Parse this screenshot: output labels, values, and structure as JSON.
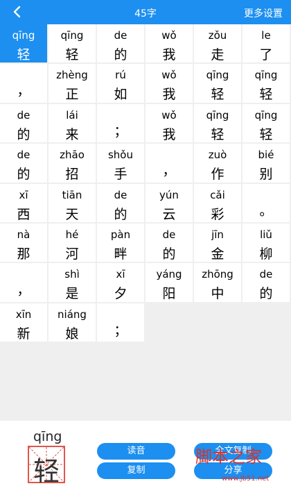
{
  "header": {
    "title": "45字",
    "more_label": "更多设置"
  },
  "cells": [
    {
      "py": "qīng",
      "hz": "轻",
      "selected": true
    },
    {
      "py": "qīng",
      "hz": "轻"
    },
    {
      "py": "de",
      "hz": "的"
    },
    {
      "py": "wǒ",
      "hz": "我"
    },
    {
      "py": "zǒu",
      "hz": "走"
    },
    {
      "py": "le",
      "hz": "了"
    },
    {
      "py": "",
      "hz": "，"
    },
    {
      "py": "zhèng",
      "hz": "正"
    },
    {
      "py": "rú",
      "hz": "如"
    },
    {
      "py": "wǒ",
      "hz": "我"
    },
    {
      "py": "qīng",
      "hz": "轻"
    },
    {
      "py": "qīng",
      "hz": "轻"
    },
    {
      "py": "de",
      "hz": "的"
    },
    {
      "py": "lái",
      "hz": "来"
    },
    {
      "py": "",
      "hz": "；"
    },
    {
      "py": "wǒ",
      "hz": "我"
    },
    {
      "py": "qīng",
      "hz": "轻"
    },
    {
      "py": "qīng",
      "hz": "轻"
    },
    {
      "py": "de",
      "hz": "的"
    },
    {
      "py": "zhāo",
      "hz": "招"
    },
    {
      "py": "shǒu",
      "hz": "手"
    },
    {
      "py": "",
      "hz": "，"
    },
    {
      "py": "zuò",
      "hz": "作"
    },
    {
      "py": "bié",
      "hz": "别"
    },
    {
      "py": "xī",
      "hz": "西"
    },
    {
      "py": "tiān",
      "hz": "天"
    },
    {
      "py": "de",
      "hz": "的"
    },
    {
      "py": "yún",
      "hz": "云"
    },
    {
      "py": "cǎi",
      "hz": "彩"
    },
    {
      "py": "",
      "hz": "。"
    },
    {
      "py": "nà",
      "hz": "那"
    },
    {
      "py": "hé",
      "hz": "河"
    },
    {
      "py": "pàn",
      "hz": "畔"
    },
    {
      "py": "de",
      "hz": "的"
    },
    {
      "py": "jīn",
      "hz": "金"
    },
    {
      "py": "liǔ",
      "hz": "柳"
    },
    {
      "py": "",
      "hz": "，"
    },
    {
      "py": "shì",
      "hz": "是"
    },
    {
      "py": "xī",
      "hz": "夕"
    },
    {
      "py": "yáng",
      "hz": "阳"
    },
    {
      "py": "zhōng",
      "hz": "中"
    },
    {
      "py": "de",
      "hz": "的"
    },
    {
      "py": "xīn",
      "hz": "新"
    },
    {
      "py": "niáng",
      "hz": "娘"
    },
    {
      "py": "",
      "hz": "；"
    }
  ],
  "preview": {
    "pinyin": "qīng",
    "char": "轻"
  },
  "buttons": {
    "read": "读音",
    "copy": "复制",
    "copy_all": "全文复制",
    "share": "分享"
  },
  "watermark": {
    "text": "脚本之家",
    "url": "www.jb51.net",
    "color": "#d9322b"
  },
  "colors": {
    "accent": "#1c8ff0",
    "grid_border": "#e0554a"
  }
}
